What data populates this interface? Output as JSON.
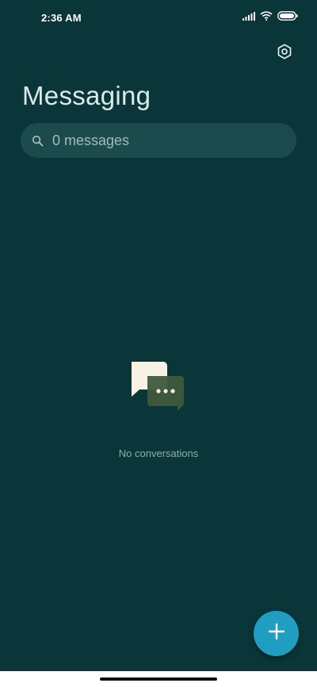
{
  "status_bar": {
    "time": "2:36 AM",
    "icons": [
      "signal-icon",
      "wifi-icon",
      "battery-icon"
    ]
  },
  "header": {
    "title": "Messaging",
    "settings_icon": "gear-icon"
  },
  "search": {
    "placeholder": "0 messages",
    "value": ""
  },
  "empty_state": {
    "icon": "chat-bubbles-icon",
    "text": "No conversations"
  },
  "fab": {
    "icon": "plus-icon"
  },
  "colors": {
    "background": "#0b3639",
    "search_bar": "#1c4b4d",
    "accent": "#1f9ec2"
  }
}
